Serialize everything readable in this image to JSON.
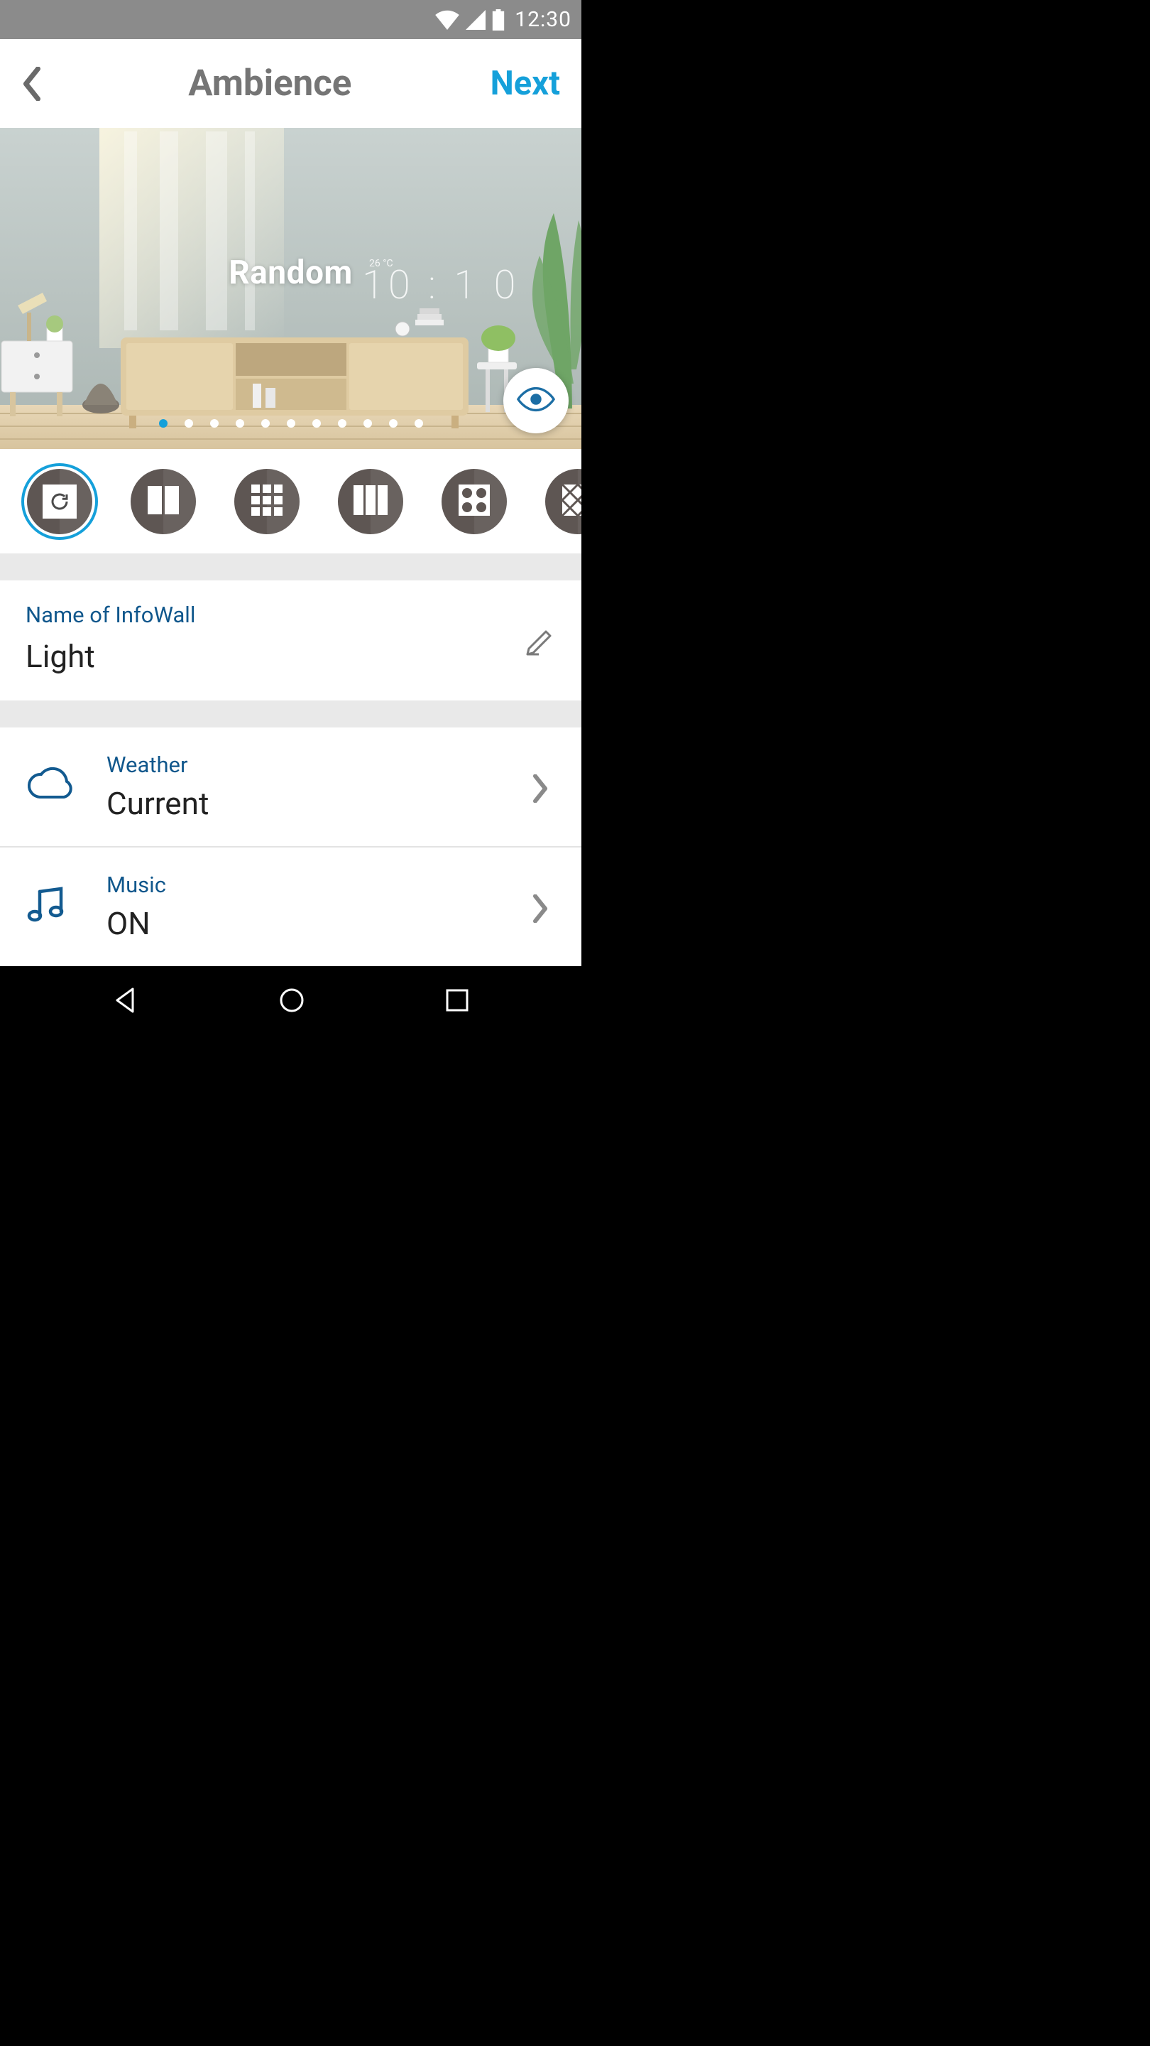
{
  "status": {
    "time": "12:30"
  },
  "header": {
    "title": "Ambience",
    "next": "Next"
  },
  "hero": {
    "label": "Random",
    "overlay": {
      "temp": "26 °C",
      "clock": "10:10"
    },
    "page_count": 11,
    "active_page": 0
  },
  "templates": [
    {
      "id": "random",
      "icon": "refresh",
      "selected": true
    },
    {
      "id": "split-2",
      "icon": "cols2",
      "selected": false
    },
    {
      "id": "grid-9",
      "icon": "grid3x3",
      "selected": false
    },
    {
      "id": "split-3",
      "icon": "cols3",
      "selected": false
    },
    {
      "id": "pattern",
      "icon": "circles",
      "selected": false
    },
    {
      "id": "diamond",
      "icon": "diamond",
      "selected": false
    }
  ],
  "name": {
    "label": "Name of InfoWall",
    "value": "Light"
  },
  "settings": [
    {
      "key": "weather",
      "label": "Weather",
      "value": "Current",
      "icon": "cloud"
    },
    {
      "key": "music",
      "label": "Music",
      "value": "ON",
      "icon": "music"
    }
  ]
}
